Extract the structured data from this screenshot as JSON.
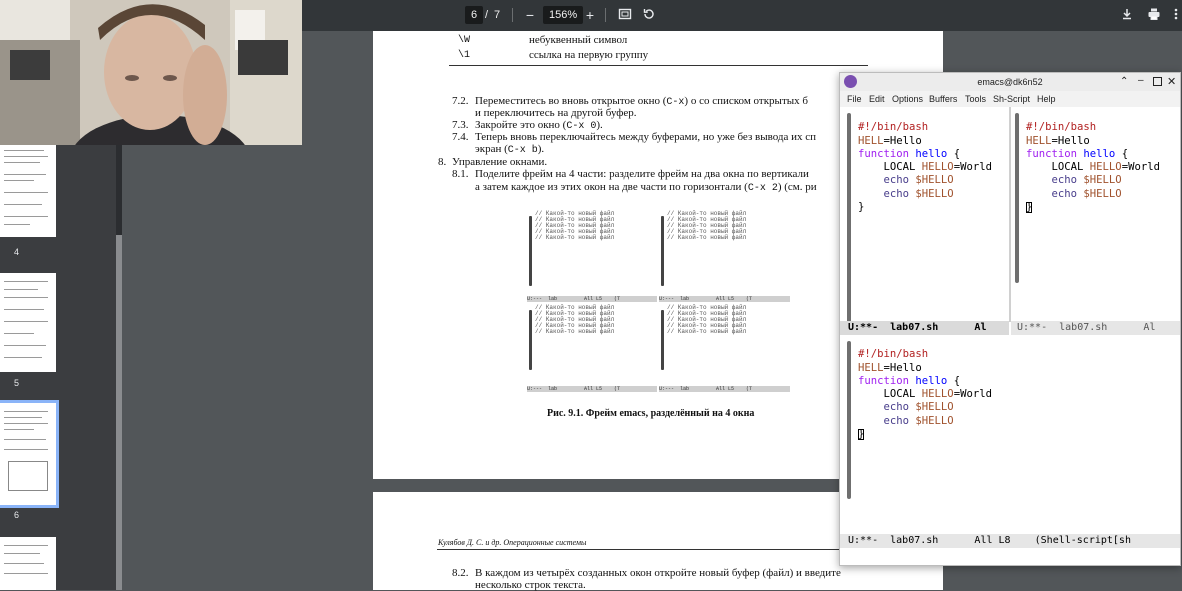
{
  "toolbar": {
    "page_current": "6",
    "page_sep": "/",
    "page_total": "7",
    "zoom": "156%",
    "icons": [
      "zoom-out-icon",
      "zoom-in-icon",
      "fit-page-icon",
      "rotate-icon",
      "download-icon",
      "print-icon",
      "more-icon"
    ],
    "minus": "−",
    "plus": "+"
  },
  "sidebar": {
    "page_labels": [
      "4",
      "5",
      "6"
    ]
  },
  "doc": {
    "table_rows": [
      {
        "code": "\\W",
        "desc": "небуквенный символ"
      },
      {
        "code": "\\1",
        "desc": "ссылка на первую группу"
      }
    ],
    "i72_num": "7.2.",
    "i72_a": "Переместитесь во вновь открытое окно (",
    "i72_code": "C-x",
    "i72_b": ") о со списком открытых б",
    "i72_line2": "и переключитесь на другой буфер.",
    "i73_num": "7.3.",
    "i73_a": "Закройте это окно (",
    "i73_code": "C-x 0",
    "i73_b": ").",
    "i74_num": "7.4.",
    "i74_a": "Теперь вновь переключайтесь между буферами, но уже без вывода их сп",
    "i74_line2a": "экран (",
    "i74_code": "C-x b",
    "i74_line2b": ").",
    "i8_num": "8.",
    "i8_text": "Управление окнами.",
    "i81_num": "8.1.",
    "i81_a": "Поделите фрейм на 4 части: разделите фрейм на два окна по вертикали",
    "i81_line2a": "а затем каждое из этих окон на две части по горизонтали (",
    "i81_code": "C-x 2",
    "i81_line2b": ") (см. ри",
    "fig_caption": "Рис. 9.1. Фрейм emacs, разделённый на 4 окна",
    "footer": "Кулябов Д. С. и др. Операционные системы",
    "i82_num": "8.2.",
    "i82_a": "В каждом из четырёх созданных окон откройте новый буфер (файл) и введите",
    "i82_line2": "несколько строк текста."
  },
  "figure": {
    "line": "// Какой-то новый файл",
    "mode_left": "U:---  lab         All L5    (T",
    "mode_right": "U:---  lab         All L5    (T"
  },
  "emacs": {
    "title": "emacs@dk6n52",
    "menu": [
      "File",
      "Edit",
      "Options",
      "Buffers",
      "Tools",
      "Sh-Script",
      "Help"
    ],
    "code": {
      "shebang": "#!/bin/bash",
      "hell_var": "HELL",
      "hell_val": "=Hello",
      "kw_function": "function",
      "fn_name": "hello",
      "brace_open": " {",
      "local_kw": "LOCAL",
      "hello_var": "HELLO",
      "world_val": "=World",
      "echo_kw": "echo",
      "echo_arg": "$HELLO",
      "brace_close": "}"
    },
    "modeline_left": "U:**-  lab07.sh      Al",
    "modeline_right": "U:**-  lab07.sh      Al",
    "modeline_bottom": "U:**-  lab07.sh      All L8    (Shell-script[sh"
  },
  "colors": {
    "toolbar_bg": "#323639",
    "viewer_bg": "#525659",
    "emacs_keyword": "#a020f0",
    "emacs_variable": "#a0522d",
    "emacs_comment": "#b22222"
  }
}
